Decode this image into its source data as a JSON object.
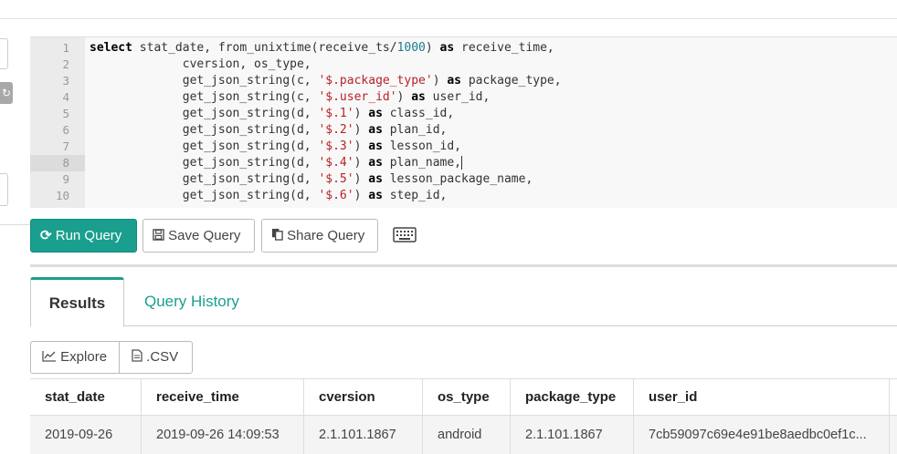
{
  "editor": {
    "lines": [
      {
        "n": "1",
        "parts": [
          [
            "kw",
            "select"
          ],
          [
            "t",
            " stat_date, from_unixtime(receive_ts/"
          ],
          [
            "num",
            "1000"
          ],
          [
            "t",
            ") "
          ],
          [
            "kw",
            "as"
          ],
          [
            "t",
            " receive_time,"
          ]
        ]
      },
      {
        "n": "2",
        "parts": [
          [
            "t",
            "             cversion, os_type,"
          ]
        ]
      },
      {
        "n": "3",
        "parts": [
          [
            "t",
            "             get_json_string(c, "
          ],
          [
            "str",
            "'$.package_type'"
          ],
          [
            "t",
            ") "
          ],
          [
            "kw",
            "as"
          ],
          [
            "t",
            " package_type,"
          ]
        ]
      },
      {
        "n": "4",
        "parts": [
          [
            "t",
            "             get_json_string(c, "
          ],
          [
            "str",
            "'$.user_id'"
          ],
          [
            "t",
            ") "
          ],
          [
            "kw",
            "as"
          ],
          [
            "t",
            " user_id,"
          ]
        ]
      },
      {
        "n": "5",
        "parts": [
          [
            "t",
            "             get_json_string(d, "
          ],
          [
            "str",
            "'$.1'"
          ],
          [
            "t",
            ") "
          ],
          [
            "kw",
            "as"
          ],
          [
            "t",
            " class_id,"
          ]
        ]
      },
      {
        "n": "6",
        "parts": [
          [
            "t",
            "             get_json_string(d, "
          ],
          [
            "str",
            "'$.2'"
          ],
          [
            "t",
            ") "
          ],
          [
            "kw",
            "as"
          ],
          [
            "t",
            " plan_id,"
          ]
        ]
      },
      {
        "n": "7",
        "parts": [
          [
            "t",
            "             get_json_string(d, "
          ],
          [
            "str",
            "'$.3'"
          ],
          [
            "t",
            ") "
          ],
          [
            "kw",
            "as"
          ],
          [
            "t",
            " lesson_id,"
          ]
        ]
      },
      {
        "n": "8",
        "parts": [
          [
            "t",
            "             get_json_string(d, "
          ],
          [
            "str",
            "'$.4'"
          ],
          [
            "t",
            ") "
          ],
          [
            "kw",
            "as"
          ],
          [
            "t",
            " plan_name,"
          ]
        ],
        "active": true
      },
      {
        "n": "9",
        "parts": [
          [
            "t",
            "             get_json_string(d, "
          ],
          [
            "str",
            "'$.5'"
          ],
          [
            "t",
            ") "
          ],
          [
            "kw",
            "as"
          ],
          [
            "t",
            " lesson_package_name,"
          ]
        ]
      },
      {
        "n": "10",
        "parts": [
          [
            "t",
            "             get_json_string(d, "
          ],
          [
            "str",
            "'$.6'"
          ],
          [
            "t",
            ") "
          ],
          [
            "kw",
            "as"
          ],
          [
            "t",
            " step_id,"
          ]
        ]
      }
    ]
  },
  "toolbar": {
    "run_label": "Run Query",
    "save_label": "Save Query",
    "share_label": "Share Query"
  },
  "tabs": {
    "results": "Results",
    "history": "Query History"
  },
  "export": {
    "explore": "Explore",
    "csv": ".CSV"
  },
  "table": {
    "columns": [
      "stat_date",
      "receive_time",
      "cversion",
      "os_type",
      "package_type",
      "user_id"
    ],
    "rows": [
      [
        "2019-09-26",
        "2019-09-26 14:09:53",
        "2.1.101.1867",
        "android",
        "2.1.101.1867",
        "7cb59097c69e4e91be8aedbc0ef1c..."
      ]
    ]
  },
  "colors": {
    "accent": "#1a9f8e",
    "keyword": "#000000",
    "string": "#b5232a",
    "number": "#1c7c8c"
  }
}
